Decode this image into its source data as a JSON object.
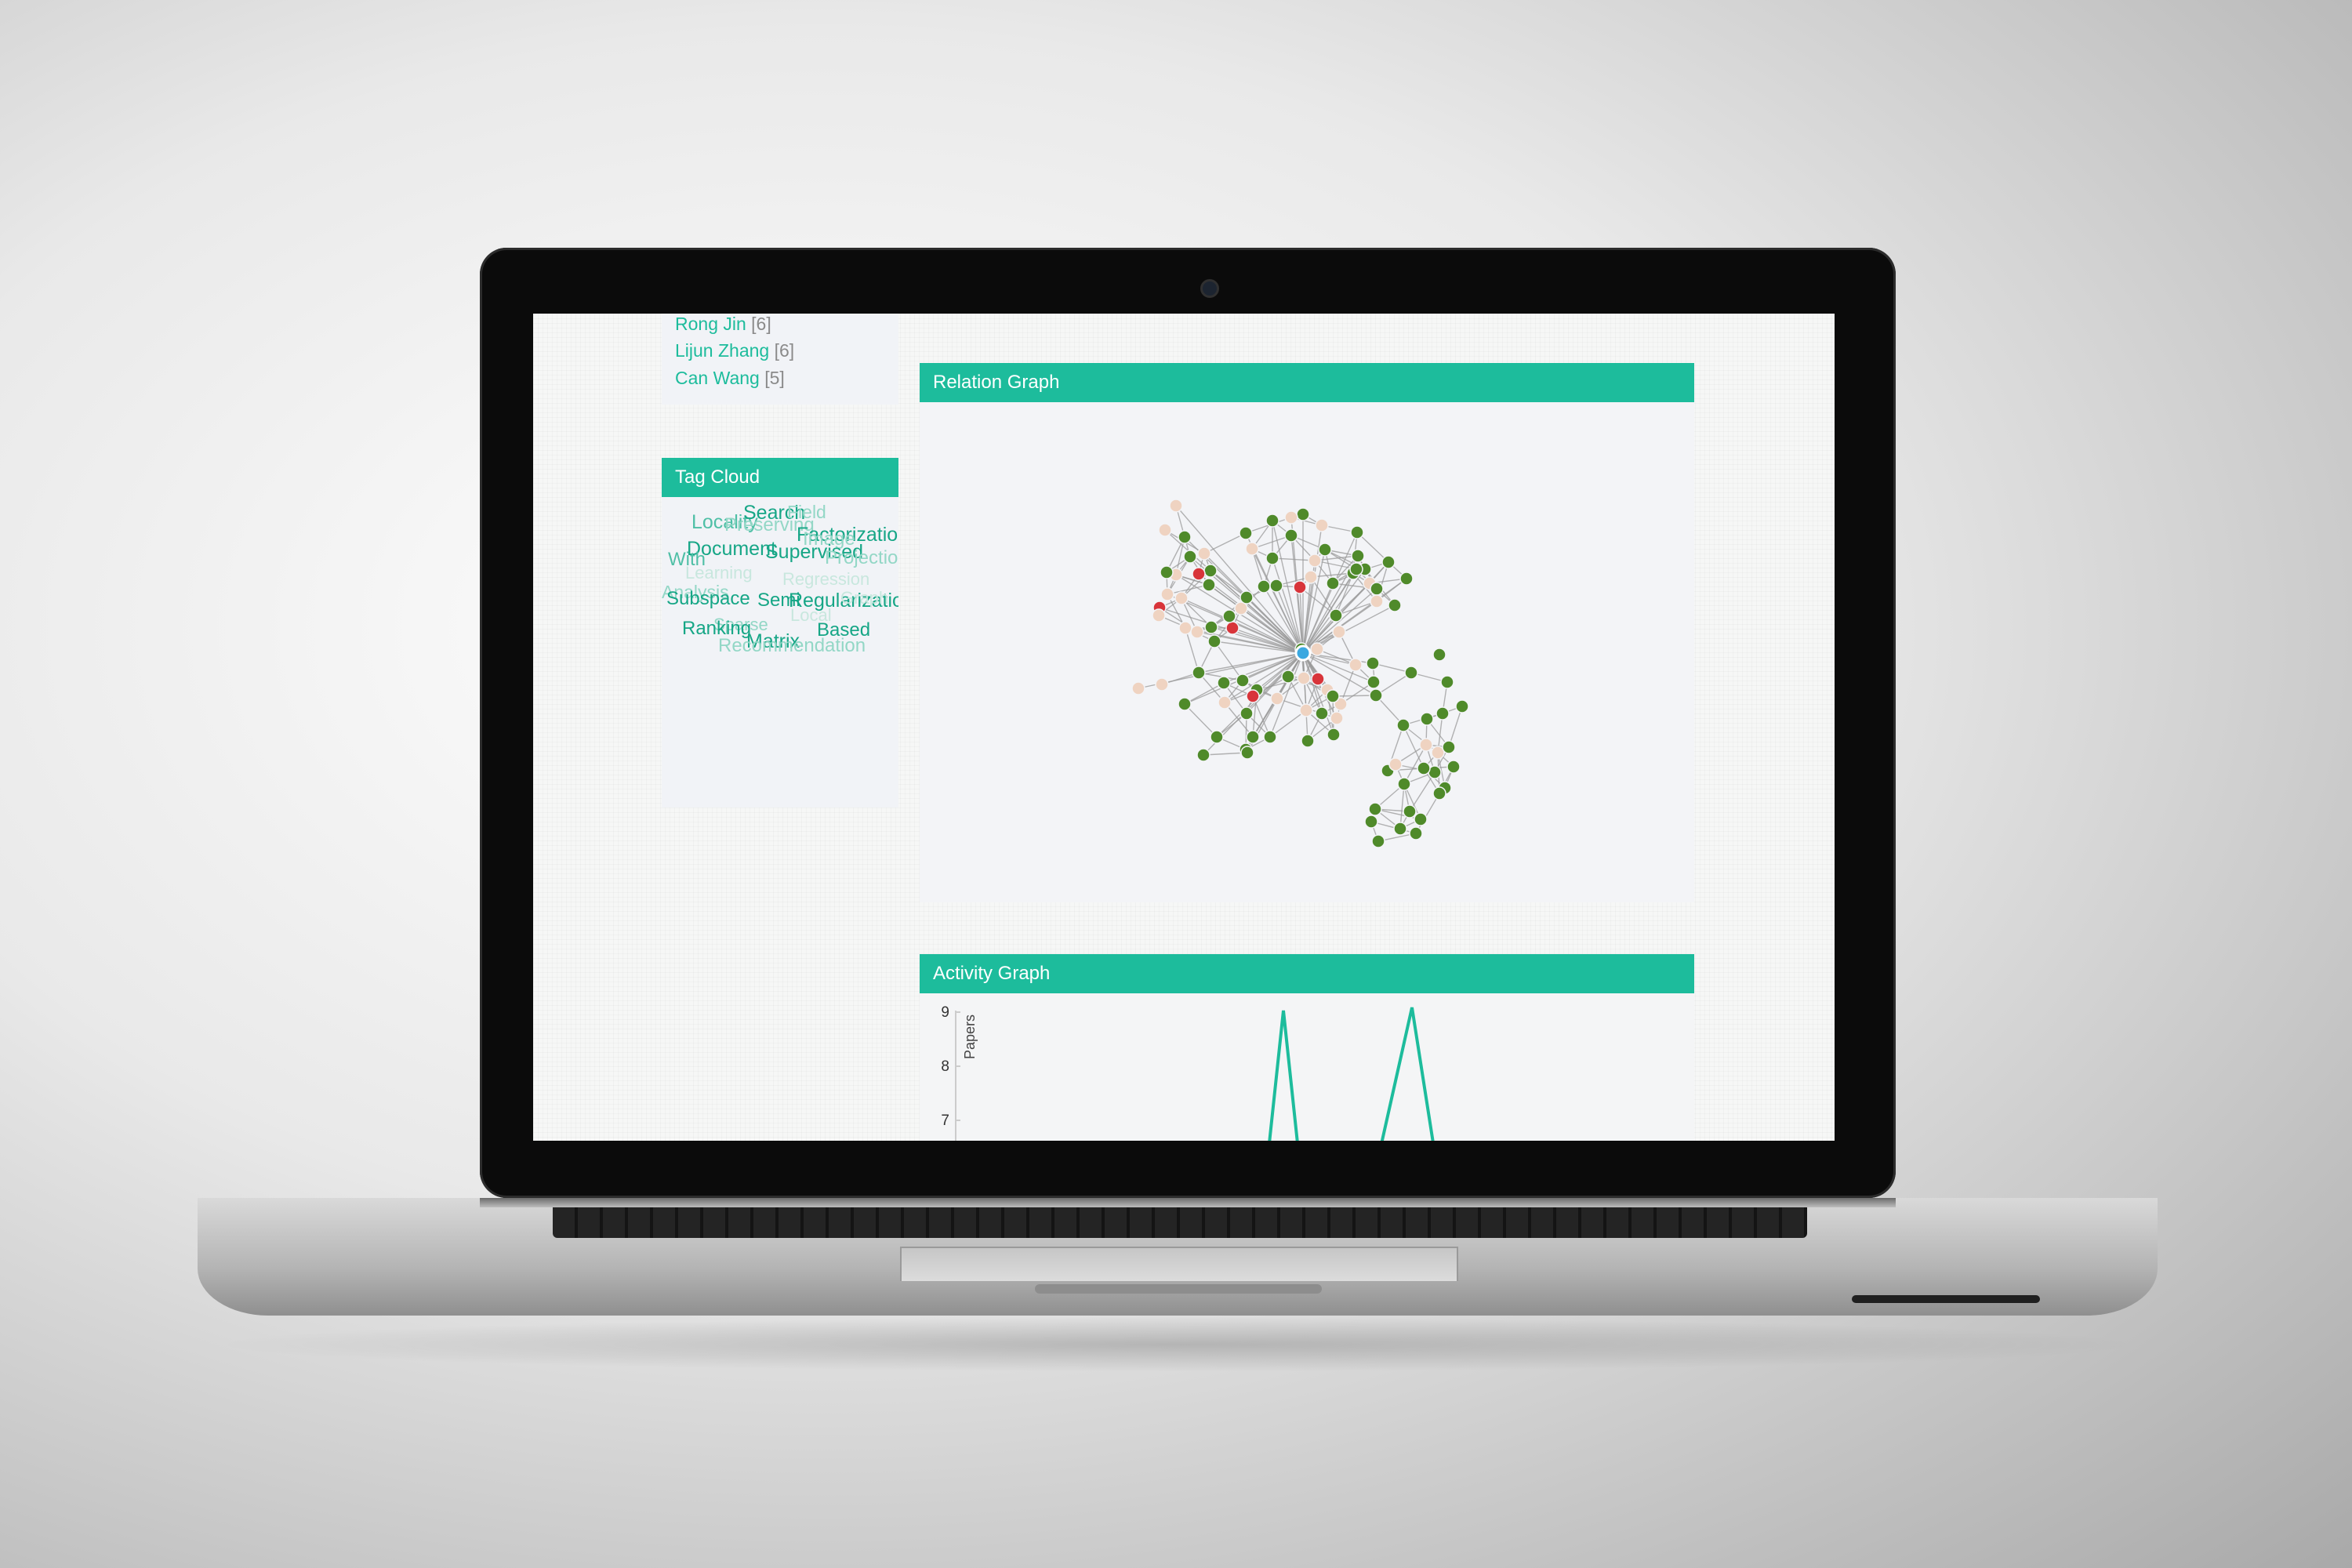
{
  "authors": [
    {
      "name": "Rong Jin",
      "count": "[6]"
    },
    {
      "name": "Lijun Zhang",
      "count": "[6]"
    },
    {
      "name": "Can Wang",
      "count": "[5]"
    }
  ],
  "tag_cloud": {
    "title": "Tag Cloud",
    "words": [
      {
        "text": "Locality",
        "tone": "mid"
      },
      {
        "text": "Search",
        "tone": "strong"
      },
      {
        "text": "Field",
        "tone": "light"
      },
      {
        "text": "Preserving",
        "tone": "light"
      },
      {
        "text": "Factorization",
        "tone": "strong"
      },
      {
        "text": "Image",
        "tone": "light"
      },
      {
        "text": "Document",
        "tone": "strong"
      },
      {
        "text": "Supervised",
        "tone": "strong"
      },
      {
        "text": "With",
        "tone": "mid"
      },
      {
        "text": "Projection",
        "tone": "light"
      },
      {
        "text": "Learning",
        "tone": "faint"
      },
      {
        "text": "Regression",
        "tone": "faint"
      },
      {
        "text": "Analysis",
        "tone": "light"
      },
      {
        "text": "Subspace",
        "tone": "strong"
      },
      {
        "text": "Semi",
        "tone": "strong"
      },
      {
        "text": "Regularization",
        "tone": "strong"
      },
      {
        "text": "Graph",
        "tone": "faint"
      },
      {
        "text": "Local",
        "tone": "faint"
      },
      {
        "text": "Sparse",
        "tone": "light"
      },
      {
        "text": "Ranking",
        "tone": "strong"
      },
      {
        "text": "Based",
        "tone": "strong"
      },
      {
        "text": "Matrix",
        "tone": "strong"
      },
      {
        "text": "Recommendation",
        "tone": "light"
      }
    ]
  },
  "relation_graph": {
    "title": "Relation Graph",
    "colors": {
      "edge": "#9a9a9a",
      "green": "#4f8a2a",
      "peach": "#efd3c1",
      "red": "#d8343a",
      "blue": "#3aa8e0"
    }
  },
  "activity_graph": {
    "title": "Activity Graph",
    "ylabel": "Papers",
    "y_ticks": [
      "9",
      "8",
      "7"
    ],
    "line_color": "#1dbc9c"
  },
  "theme": {
    "accent": "#1dbc9c"
  }
}
